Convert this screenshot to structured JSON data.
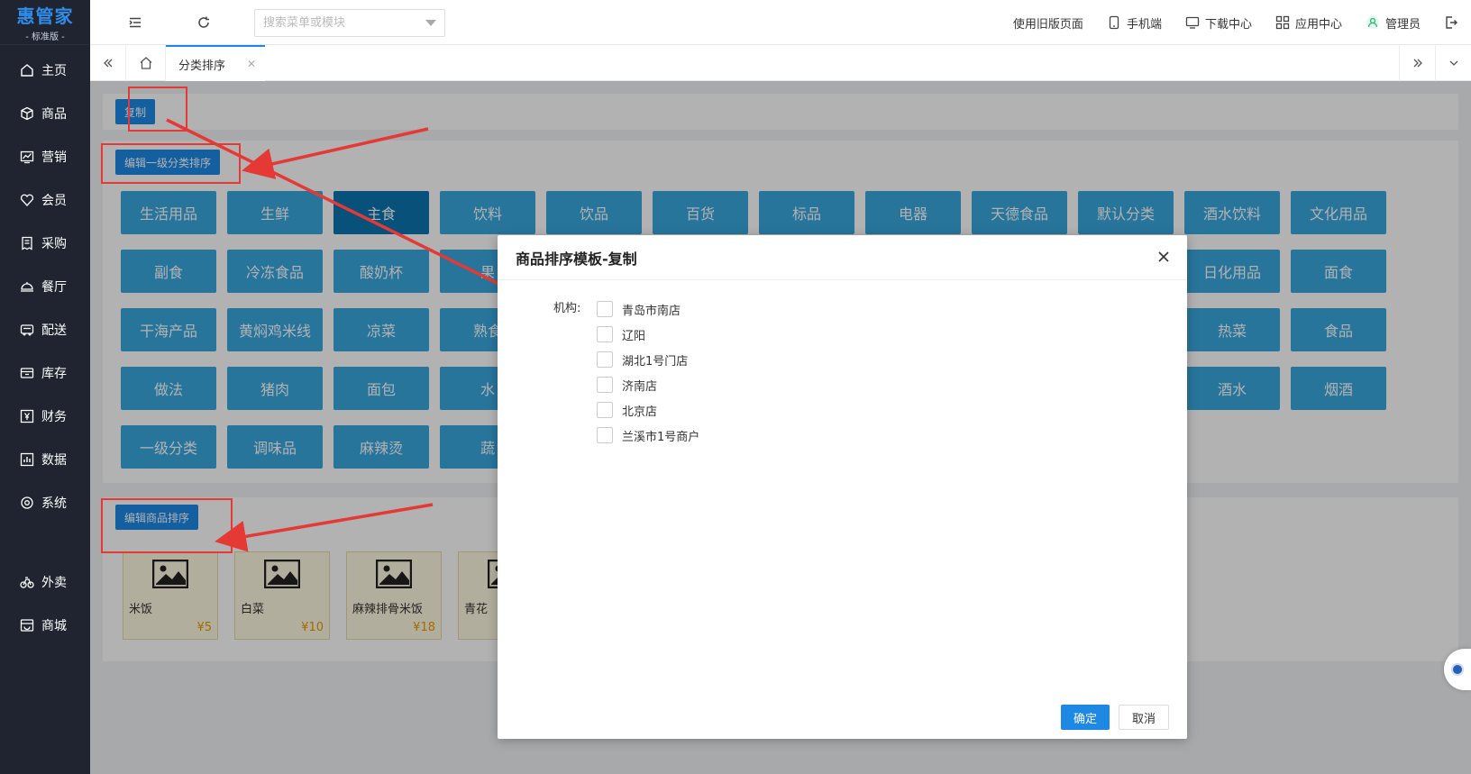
{
  "app": {
    "logo_main": "惠管家",
    "logo_sub": "- 标准版 -"
  },
  "sidebar": {
    "items": [
      {
        "label": "主页",
        "icon": "home-icon"
      },
      {
        "label": "商品",
        "icon": "box-icon"
      },
      {
        "label": "营销",
        "icon": "chart-icon"
      },
      {
        "label": "会员",
        "icon": "heart-icon"
      },
      {
        "label": "采购",
        "icon": "receipt-icon"
      },
      {
        "label": "餐厅",
        "icon": "dish-icon"
      },
      {
        "label": "配送",
        "icon": "truck-icon"
      },
      {
        "label": "库存",
        "icon": "inventory-icon"
      },
      {
        "label": "财务",
        "icon": "yen-icon"
      },
      {
        "label": "数据",
        "icon": "data-icon"
      },
      {
        "label": "系统",
        "icon": "settings-icon"
      }
    ],
    "extra_items": [
      {
        "label": "外卖",
        "icon": "bike-icon"
      },
      {
        "label": "商城",
        "icon": "store-icon"
      }
    ]
  },
  "topbar": {
    "search_placeholder": "搜索菜单或模块",
    "old_page": "使用旧版页面",
    "mobile": "手机端",
    "download": "下载中心",
    "apps": "应用中心",
    "admin": "管理员"
  },
  "tabs": {
    "active": "分类排序"
  },
  "buttons": {
    "copy": "复制",
    "edit_level1": "编辑一级分类排序",
    "edit_goods": "编辑商品排序"
  },
  "categories": [
    "生活用品",
    "生鲜",
    "主食",
    "饮料",
    "饮品",
    "百货",
    "标品",
    "电器",
    "天德食品",
    "默认分类",
    "酒水饮料",
    "文化用品",
    "副食",
    "冷冻食品",
    "酸奶杯",
    "果",
    "",
    "",
    "",
    "",
    "",
    "",
    "日化用品",
    "面食",
    "干海产品",
    "黄焖鸡米线",
    "凉菜",
    "熟食",
    "",
    "",
    "",
    "",
    "",
    "",
    "热菜",
    "食品",
    "做法",
    "猪肉",
    "面包",
    "水",
    "",
    "",
    "",
    "",
    "",
    "",
    "酒水",
    "烟酒",
    "一级分类",
    "调味品",
    "麻辣烫",
    "蔬"
  ],
  "selected_category": "主食",
  "goods": [
    {
      "name": "米饭",
      "price": "¥5"
    },
    {
      "name": "白菜",
      "price": "¥10"
    },
    {
      "name": "麻辣排骨米饭",
      "price": "¥18"
    },
    {
      "name": "青花",
      "price": ""
    }
  ],
  "modal": {
    "title": "商品排序模板-复制",
    "org_label": "机构:",
    "orgs": [
      "青岛市南店",
      "辽阳",
      "湖北1号门店",
      "济南店",
      "北京店",
      "兰溪市1号商户"
    ],
    "ok": "确定",
    "cancel": "取消"
  },
  "colors": {
    "sidebar_bg": "#1f2430",
    "primary": "#1e88e5",
    "category_tile": "#3aa8e0",
    "category_selected": "#0b74b0",
    "annotation_red": "#e53935",
    "price_orange": "#e69a00"
  }
}
